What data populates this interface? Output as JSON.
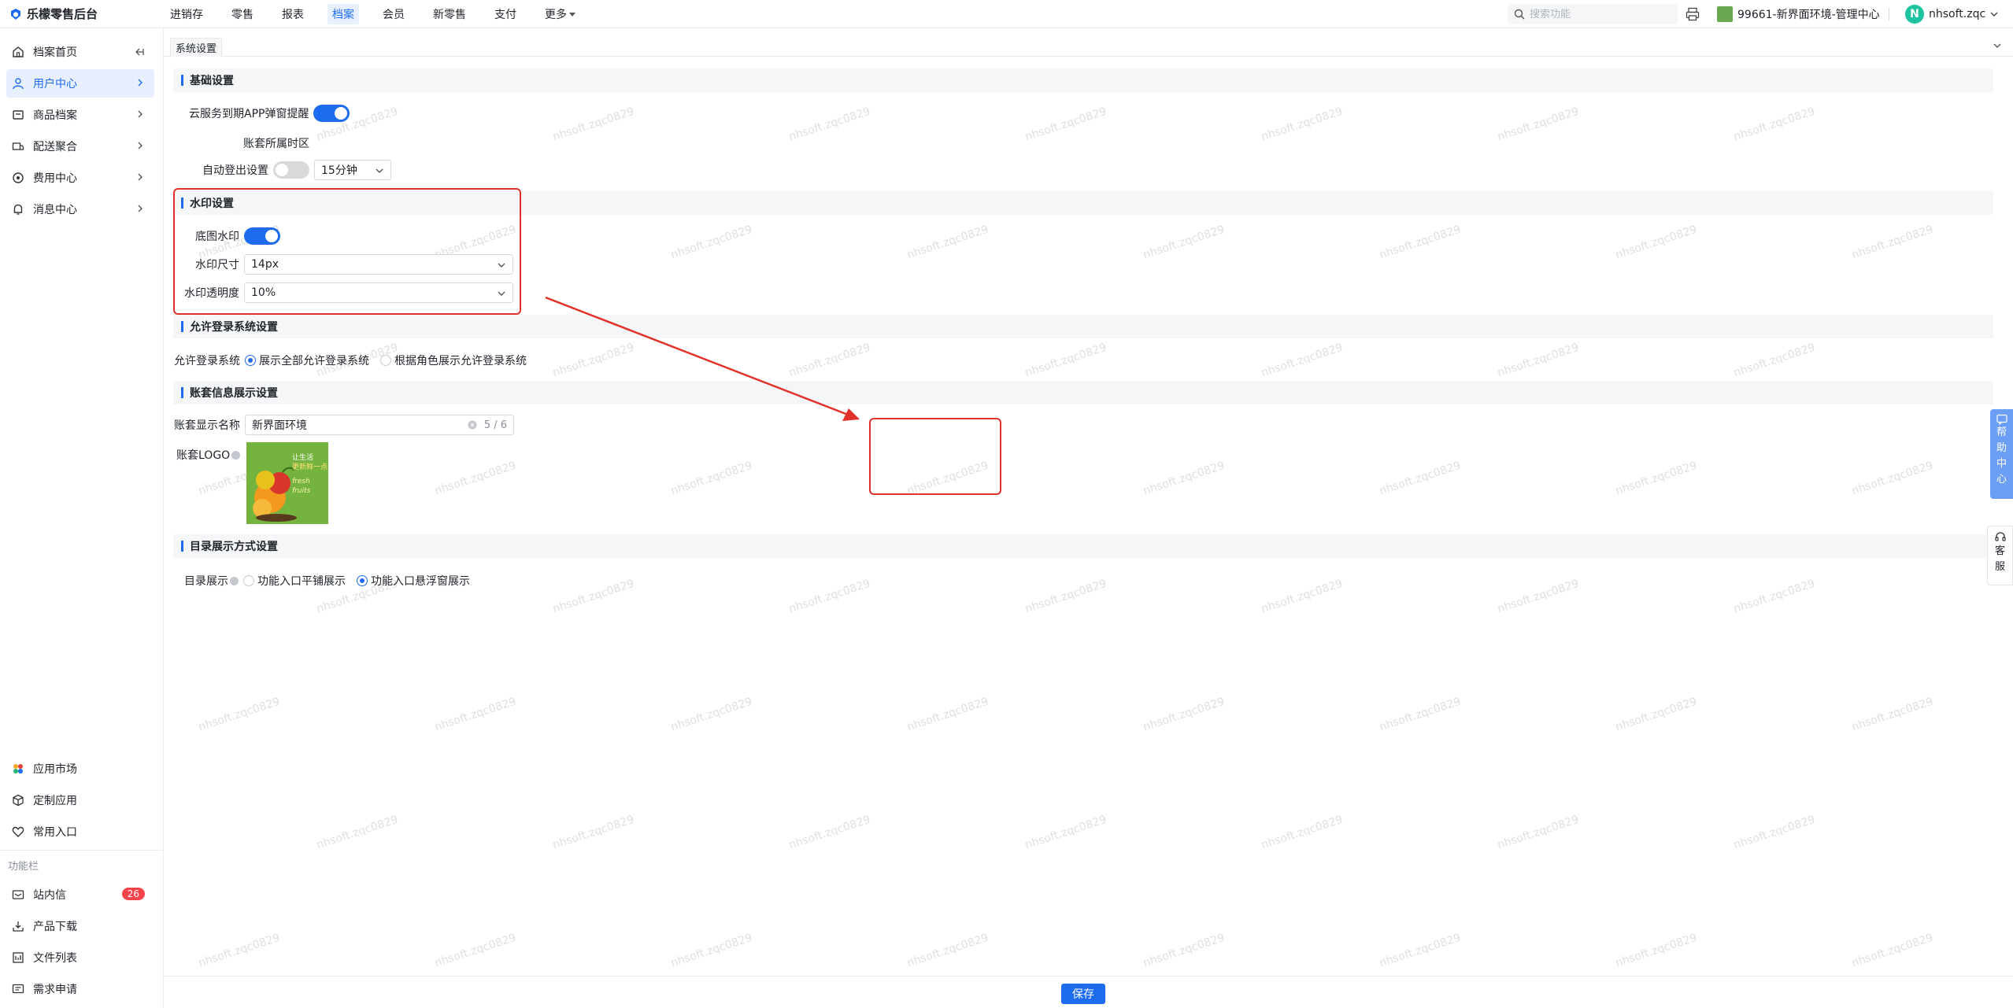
{
  "app": {
    "logo_text": "乐檬零售后台"
  },
  "topnav": {
    "items": [
      "进销存",
      "零售",
      "报表",
      "档案",
      "会员",
      "新零售",
      "支付",
      "更多"
    ],
    "active_index": 3
  },
  "search": {
    "placeholder": "搜索功能"
  },
  "store": {
    "name": "99661-新界面环境-管理中心"
  },
  "user": {
    "avatar_letter": "N",
    "name": "nhsoft.zqc"
  },
  "sidebar": {
    "items": [
      {
        "label": "档案首页",
        "icon": "home-icon"
      },
      {
        "label": "用户中心",
        "icon": "user-icon"
      },
      {
        "label": "商品档案",
        "icon": "box-icon"
      },
      {
        "label": "配送聚合",
        "icon": "truck-icon"
      },
      {
        "label": "费用中心",
        "icon": "money-icon"
      },
      {
        "label": "消息中心",
        "icon": "bell-icon"
      }
    ],
    "bottom_items": [
      {
        "label": "应用市场",
        "icon": "app-market-icon"
      },
      {
        "label": "定制应用",
        "icon": "cube-icon"
      },
      {
        "label": "常用入口",
        "icon": "heart-icon"
      }
    ],
    "section_label": "功能栏",
    "function_items": [
      {
        "label": "站内信",
        "icon": "mail-icon",
        "badge": "26"
      },
      {
        "label": "产品下载",
        "icon": "download-icon"
      },
      {
        "label": "文件列表",
        "icon": "file-list-icon"
      },
      {
        "label": "需求申请",
        "icon": "request-icon"
      }
    ]
  },
  "tab": {
    "label": "系统设置"
  },
  "sections": {
    "basic": {
      "title": "基础设置",
      "cloud_label": "云服务到期APP弹窗提醒",
      "timezone_label": "账套所属时区",
      "autologout_label": "自动登出设置",
      "autologout_value": "15分钟"
    },
    "watermark": {
      "title": "水印设置",
      "bg_label": "底图水印",
      "size_label": "水印尺寸",
      "size_value": "14px",
      "opacity_label": "水印透明度",
      "opacity_value": "10%"
    },
    "login": {
      "title": "允许登录系统设置",
      "label": "允许登录系统",
      "option1": "展示全部允许登录系统",
      "option2": "根据角色展示允许登录系统"
    },
    "account": {
      "title": "账套信息展示设置",
      "name_label": "账套显示名称",
      "name_value": "新界面环境",
      "name_count": "5 / 6",
      "logo_label": "账套LOGO",
      "logo_text1": "让生活",
      "logo_text2": "更新鲜一点",
      "logo_text3": "fresh fruits"
    },
    "directory": {
      "title": "目录展示方式设置",
      "label": "目录展示",
      "option1": "功能入口平铺展示",
      "option2": "功能入口悬浮窗展示"
    }
  },
  "save_label": "保存",
  "float": {
    "help": [
      "帮",
      "助",
      "中",
      "心"
    ],
    "service": [
      "客",
      "服"
    ]
  },
  "watermark_text": "nhsoft.zqc0829",
  "colors": {
    "primary": "#1d6cf0",
    "highlight": "#e0322a",
    "badge": "#f5444c"
  }
}
